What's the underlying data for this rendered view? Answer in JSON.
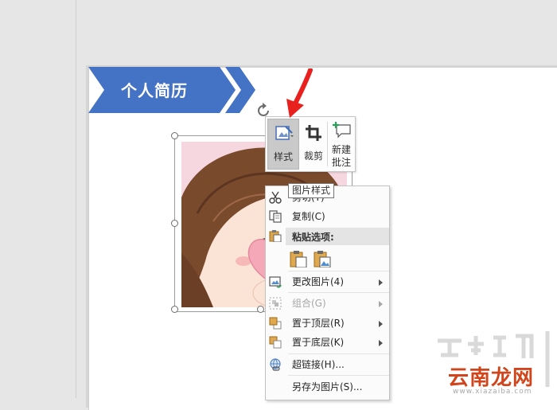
{
  "slide": {
    "banner_title": "个人简历"
  },
  "colors": {
    "banner_blue": "#4472c4",
    "arrow_red": "#e8211e",
    "watermark_red": "#d0451b"
  },
  "mini_toolbar": {
    "style_label": "样式",
    "crop_label": "裁剪",
    "new_comment_line1": "新建",
    "new_comment_line2": "批注"
  },
  "tooltip": {
    "text": "图片样式"
  },
  "context_menu": {
    "cut": "剪切(T)",
    "copy": "复制(C)",
    "paste_options_header": "粘贴选项:",
    "change_picture": "更改图片(4)",
    "group": "组合(G)",
    "bring_to_front": "置于顶层(R)",
    "send_to_back": "置于底层(K)",
    "hyperlink": "超链接(H)...",
    "save_as_picture": "另存为图片(S)..."
  },
  "watermark": {
    "brand": "云南龙网",
    "site": "www.xiazaiba.com"
  }
}
